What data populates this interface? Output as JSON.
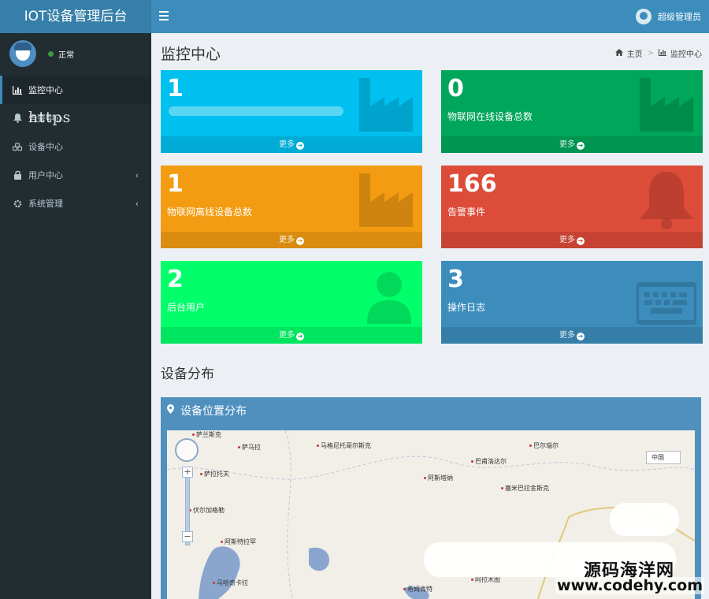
{
  "header": {
    "app_title": "IOT设备管理后台",
    "user_name": "超级管理员"
  },
  "sidebar": {
    "status": "正常",
    "watermark": "https",
    "items": [
      {
        "label": "监控中心",
        "icon": "bar-chart-icon",
        "active": true
      },
      {
        "label": "告警中心",
        "icon": "bell-icon",
        "active": false
      },
      {
        "label": "设备中心",
        "icon": "cubes-icon",
        "active": false
      },
      {
        "label": "用户中心",
        "icon": "lock-icon",
        "active": false,
        "has_children": true
      },
      {
        "label": "系统管理",
        "icon": "gear-icon",
        "active": false,
        "has_children": true
      }
    ]
  },
  "page": {
    "title": "监控中心",
    "breadcrumb": {
      "home": "主页",
      "current": "监控中心"
    }
  },
  "stats": [
    {
      "value": "1",
      "label": "",
      "color": "#00c0ef",
      "icon": "industry-icon",
      "more": "更多"
    },
    {
      "value": "0",
      "label": "物联网在线设备总数",
      "color": "#00a65a",
      "icon": "industry-icon",
      "more": "更多"
    },
    {
      "value": "1",
      "label": "物联网离线设备总数",
      "color": "#f39c12",
      "icon": "industry-icon",
      "more": "更多"
    },
    {
      "value": "166",
      "label": "告警事件",
      "color": "#dd4b39",
      "icon": "bell-icon",
      "more": "更多"
    },
    {
      "value": "2",
      "label": "后台用户",
      "color": "#00ff6a",
      "icon": "user-icon",
      "more": "更多"
    },
    {
      "value": "3",
      "label": "操作日志",
      "color": "#3c8dbc",
      "icon": "keyboard-icon",
      "more": "更多"
    }
  ],
  "distribution": {
    "section_title": "设备分布",
    "map_title": "设备位置分布",
    "map_type": "中国",
    "cities": [
      "萨兰斯克",
      "萨马拉",
      "马格尼托哥尔斯克",
      "巴尔瑙尔",
      "巴甫洛达尔",
      "萨拉托夫",
      "阿斯塔纳",
      "塞米巴拉金斯克",
      "伏尔加格勒",
      "阿斯特拉罕",
      "马哈奇卡拉",
      "希姆肯特",
      "阿拉木图"
    ]
  },
  "watermark": {
    "cn": "源码海洋网",
    "en": "www.codehy.com"
  }
}
